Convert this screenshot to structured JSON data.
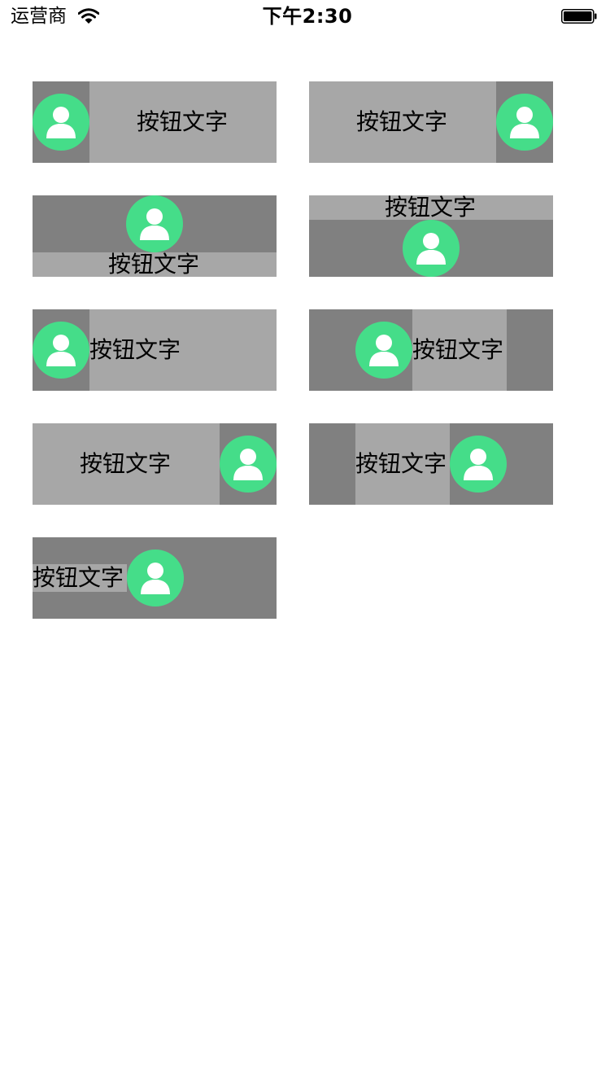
{
  "status_bar": {
    "carrier": "运营商",
    "time": "下午2:30"
  },
  "buttons": [
    {
      "label": "按钮文字",
      "layout": "image-left"
    },
    {
      "label": "按钮文字",
      "layout": "image-right"
    },
    {
      "label": "按钮文字",
      "layout": "image-top"
    },
    {
      "label": "按钮文字",
      "layout": "image-bottom"
    },
    {
      "label": "按钮文字",
      "layout": "image-left-content-left"
    },
    {
      "label": "按钮文字",
      "layout": "image-left-content-center"
    },
    {
      "label": "按钮文字",
      "layout": "image-right-text-center"
    },
    {
      "label": "按钮文字",
      "layout": "image-right-content-center"
    },
    {
      "label": "按钮文字",
      "layout": "image-right-content-left"
    }
  ],
  "colors": {
    "avatar": "#45dd89",
    "button_light": "#a7a7a7",
    "button_dark": "#808080"
  },
  "icons": {
    "button_image": "person-avatar-icon",
    "wifi": "wifi-icon",
    "battery": "battery-icon"
  }
}
